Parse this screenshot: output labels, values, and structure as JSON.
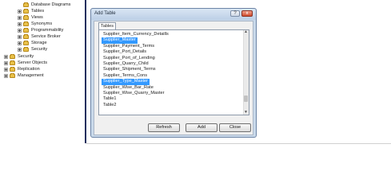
{
  "explorer": {
    "items": [
      {
        "label": "Database Diagrams"
      },
      {
        "label": "Tables"
      },
      {
        "label": "Views"
      },
      {
        "label": "Synonyms"
      },
      {
        "label": "Programmability"
      },
      {
        "label": "Service Broker"
      },
      {
        "label": "Storage"
      },
      {
        "label": "Security"
      },
      {
        "label": "Security"
      },
      {
        "label": "Server Objects"
      },
      {
        "label": "Replication"
      },
      {
        "label": "Management"
      }
    ]
  },
  "dialog": {
    "title": "Add Table",
    "help_glyph": "?",
    "close_glyph": "x",
    "tab_label": "Tables",
    "tables": [
      {
        "label": "Supplier_Item_Currency_Detaills"
      },
      {
        "label": "Supplier_Master"
      },
      {
        "label": "Supplier_Payment_Terms"
      },
      {
        "label": "Supplier_Port_Details"
      },
      {
        "label": "Supplier_Port_of_Lending"
      },
      {
        "label": "Supplier_Quarry_Child"
      },
      {
        "label": "Supplier_Shipment_Terms"
      },
      {
        "label": "Supplier_Terms_Cons"
      },
      {
        "label": "Supplier_Type_Master"
      },
      {
        "label": "Supplier_Wise_Bar_Rate"
      },
      {
        "label": "Supplier_Wise_Quarry_Master"
      },
      {
        "label": "Table1"
      },
      {
        "label": "Table2"
      }
    ],
    "selected_tables": [
      "Supplier_Master",
      "Supplier_Type_Master"
    ],
    "buttons": {
      "refresh": "Refresh",
      "add": "Add",
      "close": "Close"
    }
  }
}
